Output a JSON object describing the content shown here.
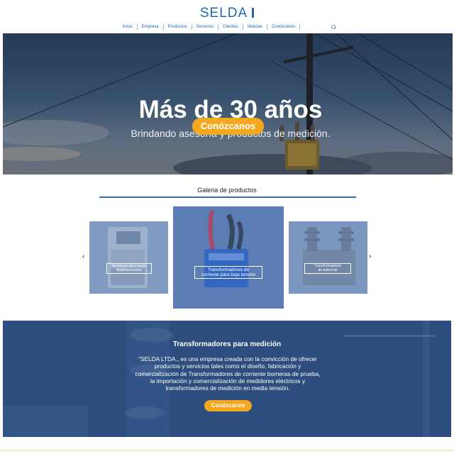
{
  "header": {
    "logo": "SELDA",
    "nav": [
      "Inicio",
      "Empresa",
      "Productos",
      "Servicios",
      "Clientes",
      "Noticias",
      "Conózcanos"
    ]
  },
  "hero": {
    "title": "Más de 30 años",
    "subtitle": "Brindando asesoría y productos de medición.",
    "button": "Conózcanos"
  },
  "gallery": {
    "title": "Galeria de productos",
    "prev": "‹",
    "next": "›",
    "cards": [
      {
        "label_line1": "Medidores de Energía",
        "label_line2": "Multifuncionales"
      },
      {
        "label_line1": "Transformadores de",
        "label_line2": "corriente para baja tensión"
      },
      {
        "label_line1": "Transformadores",
        "label_line2": "de potencial"
      }
    ]
  },
  "about": {
    "title": "Transformadores para medición",
    "text": "“SELDA LTDA., es una empresa creada con la convicción de ofrecer productos y servicios tales como el diseño, fabricación y comercialización de Transformadores de corriente borneras de prueba, la importación y comercialización de medidores eléctricos y transformadores de medición en media tensión.",
    "button": "Conózcanos"
  },
  "colors": {
    "brand_blue": "#1f66b5",
    "accent_orange": "#f2a91f",
    "section_blue": "#2c4d7d"
  }
}
